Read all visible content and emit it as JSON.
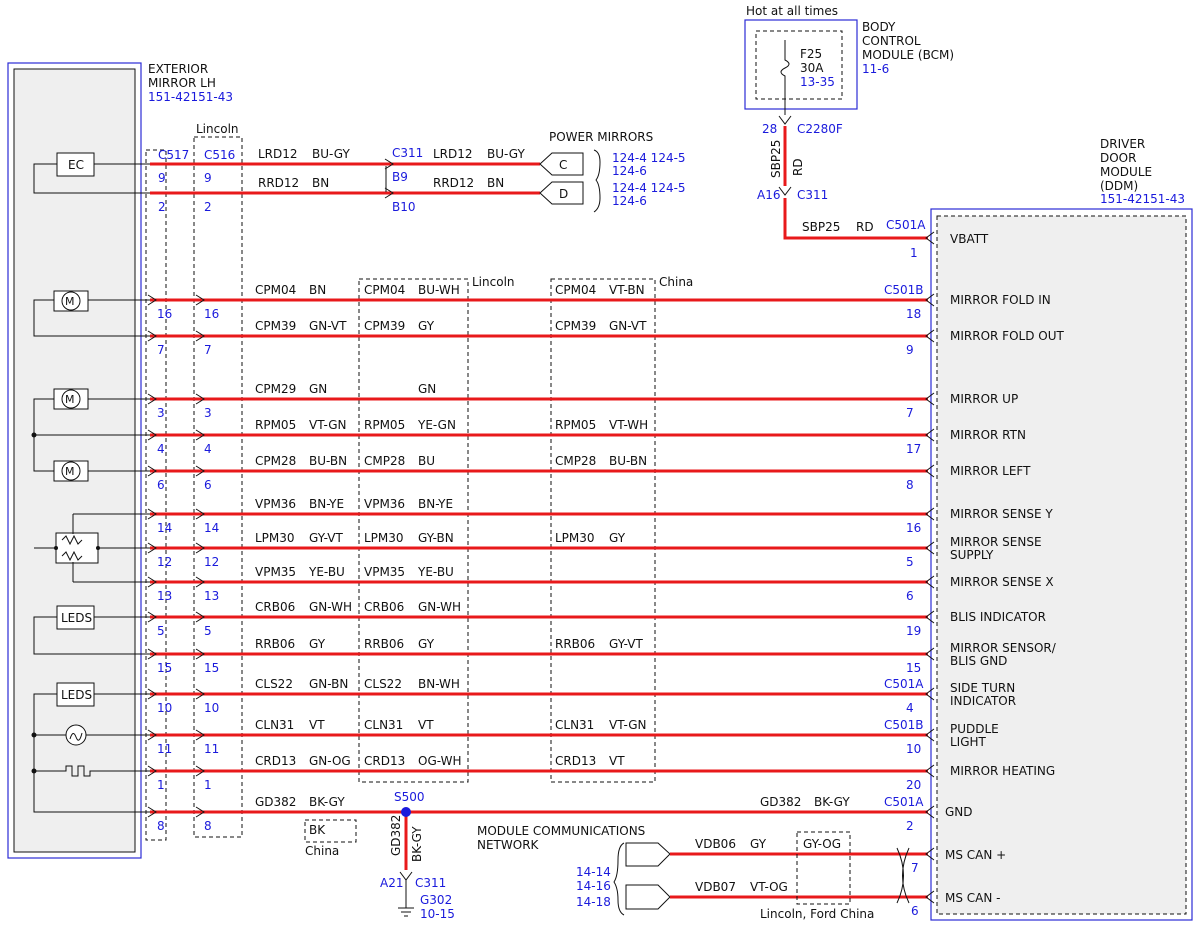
{
  "header": {
    "hot_label": "Hot at all times",
    "bcm_name": [
      "BODY",
      "CONTROL",
      "MODULE (BCM)"
    ],
    "bcm_ref": "11-6",
    "fuse_name": "F25",
    "fuse_amp": "30A",
    "fuse_ref": "13-35",
    "bcm_pin": "28",
    "bcm_conn": "C2280F",
    "vwire_name": "SBP25",
    "vwire_color": "RD",
    "vconn_pin": "A16",
    "vconn": "C311"
  },
  "mirror": {
    "name": [
      "EXTERIOR",
      "MIRROR LH"
    ],
    "refs": "151-42151-43",
    "lincoln_label": "Lincoln",
    "conn_a": "C517",
    "conn_b": "C516",
    "ec_label": "EC",
    "motor_label": "M",
    "leds_label": "LEDS"
  },
  "power_mirrors": {
    "title": "POWER MIRRORS",
    "c_label": "C",
    "d_label": "D",
    "c_refs": [
      "124-4 124-5",
      "124-6"
    ],
    "d_refs": [
      "124-4 124-5",
      "124-6"
    ],
    "conn": "C311",
    "pin_b9": "B9",
    "pin_b10": "B10",
    "rows": [
      {
        "pins": [
          "9",
          "9"
        ],
        "wire": "LRD12",
        "color": "BU-GY",
        "wire2": "LRD12",
        "color2": "BU-GY"
      },
      {
        "pins": [
          "2",
          "2"
        ],
        "wire": "RRD12",
        "color": "BN",
        "wire2": "RRD12",
        "color2": "BN"
      }
    ]
  },
  "ddm": {
    "name": [
      "DRIVER",
      "DOOR",
      "MODULE",
      "(DDM)"
    ],
    "refs": "151-42151-43",
    "vbatt_conn": "C501A",
    "vbatt_pin": "1",
    "vbatt_wire": "SBP25",
    "vbatt_color": "RD",
    "vbatt_label": "VBATT"
  },
  "regions": {
    "lincoln": "Lincoln",
    "china": "China",
    "bk": "BK",
    "bk_china": "China"
  },
  "rows": [
    {
      "pa": "16",
      "pb": "16",
      "w1": "CPM04",
      "c1": "BN",
      "w2": "CPM04",
      "c2": "BU-WH",
      "w3": "CPM04",
      "c3": "VT-BN",
      "conn": "C501B",
      "pin": "18",
      "signal": [
        "MIRROR FOLD IN"
      ]
    },
    {
      "pa": "7",
      "pb": "7",
      "w1": "CPM39",
      "c1": "GN-VT",
      "w2": "CPM39",
      "c2": "GY",
      "w3": "CPM39",
      "c3": "GN-VT",
      "conn": "",
      "pin": "9",
      "signal": [
        "MIRROR FOLD OUT"
      ]
    },
    {
      "pa": "3",
      "pb": "3",
      "w1": "CPM29",
      "c1": "GN",
      "w2": "",
      "c2": "GN",
      "w3": "",
      "c3": "",
      "conn": "",
      "pin": "7",
      "signal": [
        "MIRROR UP"
      ]
    },
    {
      "pa": "4",
      "pb": "4",
      "w1": "RPM05",
      "c1": "VT-GN",
      "w2": "RPM05",
      "c2": "YE-GN",
      "w3": "RPM05",
      "c3": "VT-WH",
      "conn": "",
      "pin": "17",
      "signal": [
        "MIRROR RTN"
      ]
    },
    {
      "pa": "6",
      "pb": "6",
      "w1": "CPM28",
      "c1": "BU-BN",
      "w2": "CMP28",
      "c2": "BU",
      "w3": "CMP28",
      "c3": "BU-BN",
      "conn": "",
      "pin": "8",
      "signal": [
        "MIRROR LEFT"
      ]
    },
    {
      "pa": "14",
      "pb": "14",
      "w1": "VPM36",
      "c1": "BN-YE",
      "w2": "VPM36",
      "c2": "BN-YE",
      "w3": "",
      "c3": "",
      "conn": "",
      "pin": "16",
      "signal": [
        "MIRROR SENSE Y"
      ]
    },
    {
      "pa": "12",
      "pb": "12",
      "w1": "LPM30",
      "c1": "GY-VT",
      "w2": "LPM30",
      "c2": "GY-BN",
      "w3": "LPM30",
      "c3": "GY",
      "conn": "",
      "pin": "5",
      "signal": [
        "MIRROR SENSE",
        "SUPPLY"
      ]
    },
    {
      "pa": "13",
      "pb": "13",
      "w1": "VPM35",
      "c1": "YE-BU",
      "w2": "VPM35",
      "c2": "YE-BU",
      "w3": "",
      "c3": "",
      "conn": "",
      "pin": "6",
      "signal": [
        "MIRROR SENSE X"
      ]
    },
    {
      "pa": "5",
      "pb": "5",
      "w1": "CRB06",
      "c1": "GN-WH",
      "w2": "CRB06",
      "c2": "GN-WH",
      "w3": "",
      "c3": "",
      "conn": "",
      "pin": "19",
      "signal": [
        "BLIS INDICATOR"
      ]
    },
    {
      "pa": "15",
      "pb": "15",
      "w1": "RRB06",
      "c1": "GY",
      "w2": "RRB06",
      "c2": "GY",
      "w3": "RRB06",
      "c3": "GY-VT",
      "conn": "",
      "pin": "15",
      "signal": [
        "MIRROR SENSOR/",
        "BLIS GND"
      ]
    },
    {
      "pa": "10",
      "pb": "10",
      "w1": "CLS22",
      "c1": "GN-BN",
      "w2": "CLS22",
      "c2": "BN-WH",
      "w3": "",
      "c3": "",
      "conn": "C501A",
      "pin": "4",
      "signal": [
        "SIDE TURN",
        "INDICATOR"
      ]
    },
    {
      "pa": "11",
      "pb": "11",
      "w1": "CLN31",
      "c1": "VT",
      "w2": "CLN31",
      "c2": "VT",
      "w3": "CLN31",
      "c3": "VT-GN",
      "conn": "C501B",
      "pin": "10",
      "signal": [
        "PUDDLE",
        "LIGHT"
      ]
    },
    {
      "pa": "1",
      "pb": "1",
      "w1": "CRD13",
      "c1": "GN-OG",
      "w2": "CRD13",
      "c2": "OG-WH",
      "w3": "CRD13",
      "c3": "VT",
      "conn": "",
      "pin": "20",
      "signal": [
        "MIRROR HEATING"
      ]
    },
    {
      "pa": "8",
      "pb": "8",
      "w1": "GD382",
      "c1": "BK-GY",
      "w2": "",
      "c2": "",
      "w3": "GD382",
      "c3": "BK-GY",
      "conn": "C501A",
      "pin": "2",
      "signal": [
        "GND"
      ]
    }
  ],
  "ground": {
    "splice": "S500",
    "wire": "GD382",
    "color": "BK-GY",
    "pin": "A21",
    "conn": "C311",
    "gnd": "G302",
    "ref": "10-15"
  },
  "network": {
    "title": [
      "MODULE COMMUNICATIONS",
      "NETWORK"
    ],
    "refs": [
      "14-14",
      "14-16",
      "14-18"
    ],
    "can_plus": {
      "wire": "VDB06",
      "color": "GY",
      "alt": "GY-OG",
      "pin": "7",
      "label": "MS CAN +"
    },
    "can_minus": {
      "wire": "VDB07",
      "color": "VT-OG",
      "pin": "6",
      "label": "MS CAN -"
    },
    "note": "Lincoln, Ford China"
  }
}
